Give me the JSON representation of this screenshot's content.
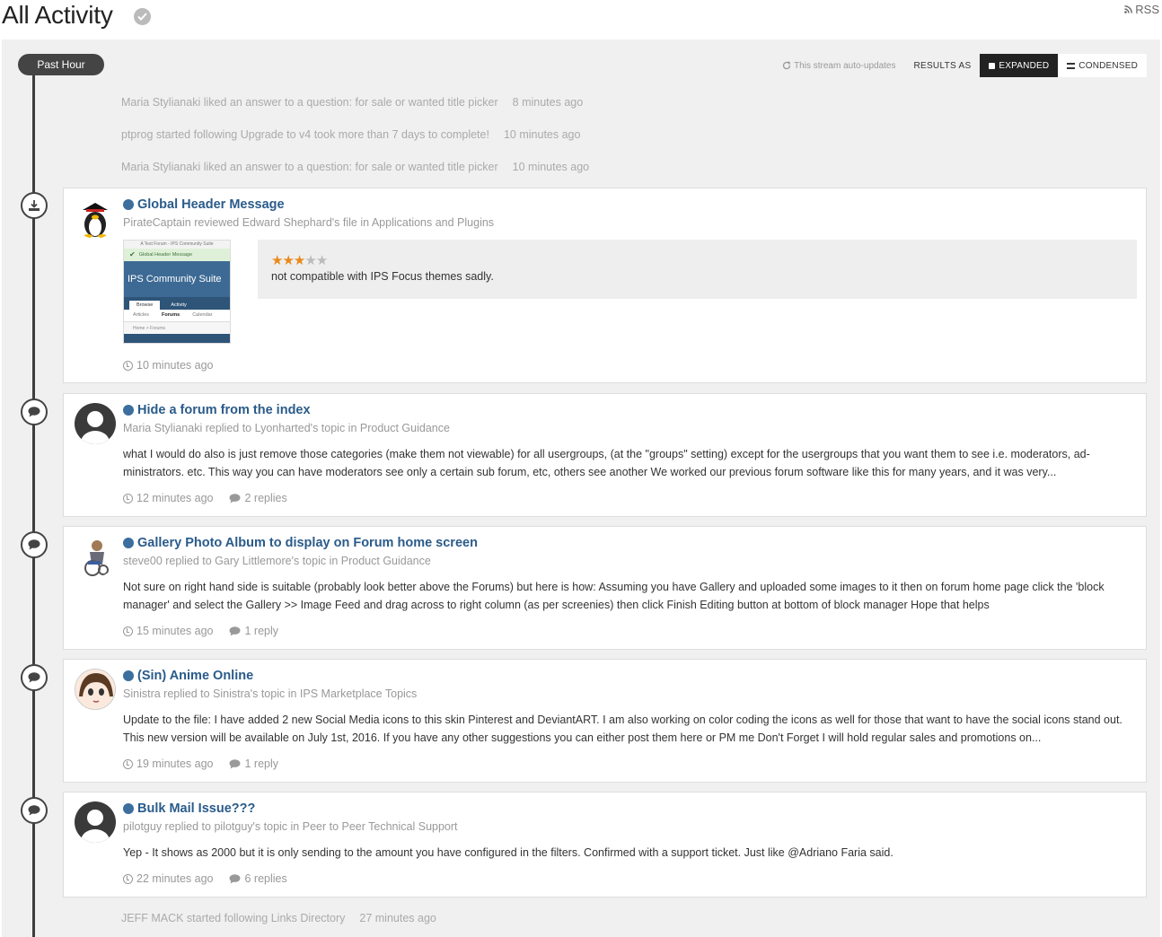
{
  "header": {
    "title": "All Activity",
    "rss_label": "RSS"
  },
  "stream": {
    "time_group": "Past Hour",
    "auto_updates": "This stream auto-updates",
    "results_as": "RESULTS AS",
    "expanded": "EXPANDED",
    "condensed": "CONDENSED"
  },
  "mini_items": [
    {
      "text": "Maria Stylianaki liked an answer to a question: for sale or wanted title picker",
      "time": "8 minutes ago"
    },
    {
      "text": "ptprog started following Upgrade to v4 took more than 7 days to complete!",
      "time": "10 minutes ago"
    },
    {
      "text": "Maria Stylianaki liked an answer to a question: for sale or wanted title picker",
      "time": "10 minutes ago"
    },
    {
      "text": "JEFF MACK started following Links Directory",
      "time": "27 minutes ago"
    }
  ],
  "cards": [
    {
      "title": "Global Header Message",
      "meta": "PirateCaptain reviewed Edward Shephard's file in Applications and Plugins",
      "rating": 3,
      "review": "not compatible with IPS Focus themes sadly.",
      "time": "10 minutes ago",
      "screenshot": {
        "topbar": "A Test Forum - IPS Community Suite",
        "message": "Global Header Message",
        "brand": "IPS Community Suite",
        "tab_browse": "Browse",
        "tab_activity": "Activity",
        "nav_articles": "Articles",
        "nav_forums": "Forums",
        "nav_calendar": "Calendar",
        "crumb": "Home > Forums"
      }
    },
    {
      "title": "Hide a forum from the index",
      "meta": "Maria Stylianaki replied to Lyonharted's topic in Product Guidance",
      "body": "what I would do also is just remove those categories (make them not viewable) for all usergroups, (at the \"groups\" setting) except for the usergroups that you want them to see i.e. moderators, ad- ministrators. etc. This way you can have moderators see only a certain sub forum, etc, others see another We worked our previous forum software like this for many years, and it was very...",
      "time": "12 minutes ago",
      "replies": "2 replies"
    },
    {
      "title": "Gallery Photo Album to display on Forum home screen",
      "meta": "steve00 replied to Gary Littlemore's topic in Product Guidance",
      "body": "Not sure on right hand side is suitable (probably look better above the Forums) but here is how: Assuming you have Gallery and uploaded some images to it then on forum home page click the 'block manager' and select the Gallery >> Image Feed and drag across to right column (as per screenies) then click Finish Editing button at bottom of block manager Hope that helps",
      "time": "15 minutes ago",
      "replies": "1 reply"
    },
    {
      "title": "(Sin) Anime Online",
      "meta": "Sinistra replied to Sinistra's topic in IPS Marketplace Topics",
      "body": "Update to the file: I have added 2 new Social Media icons to this skin Pinterest and DeviantART. I am also working on color coding the icons as well for those that want to have the social icons stand out. This new version will be available on July 1st, 2016. If you have any other suggestions you can either post them here or PM me Don't Forget I will hold regular sales and promotions on...",
      "time": "19 minutes ago",
      "replies": "1 reply"
    },
    {
      "title": "Bulk Mail Issue???",
      "meta": "pilotguy replied to pilotguy's topic in Peer to Peer Technical Support",
      "body": "Yep - It shows as 2000 but it is only sending to the amount you have configured in the filters. Confirmed with a support ticket. Just like @Adriano Faria said.",
      "time": "22 minutes ago",
      "replies": "6 replies"
    }
  ],
  "colors": {
    "link": "#2a5b8a",
    "timeline": "#3d3d3d",
    "stream_bg": "#f0f0f0",
    "star": "#e98a1a"
  }
}
